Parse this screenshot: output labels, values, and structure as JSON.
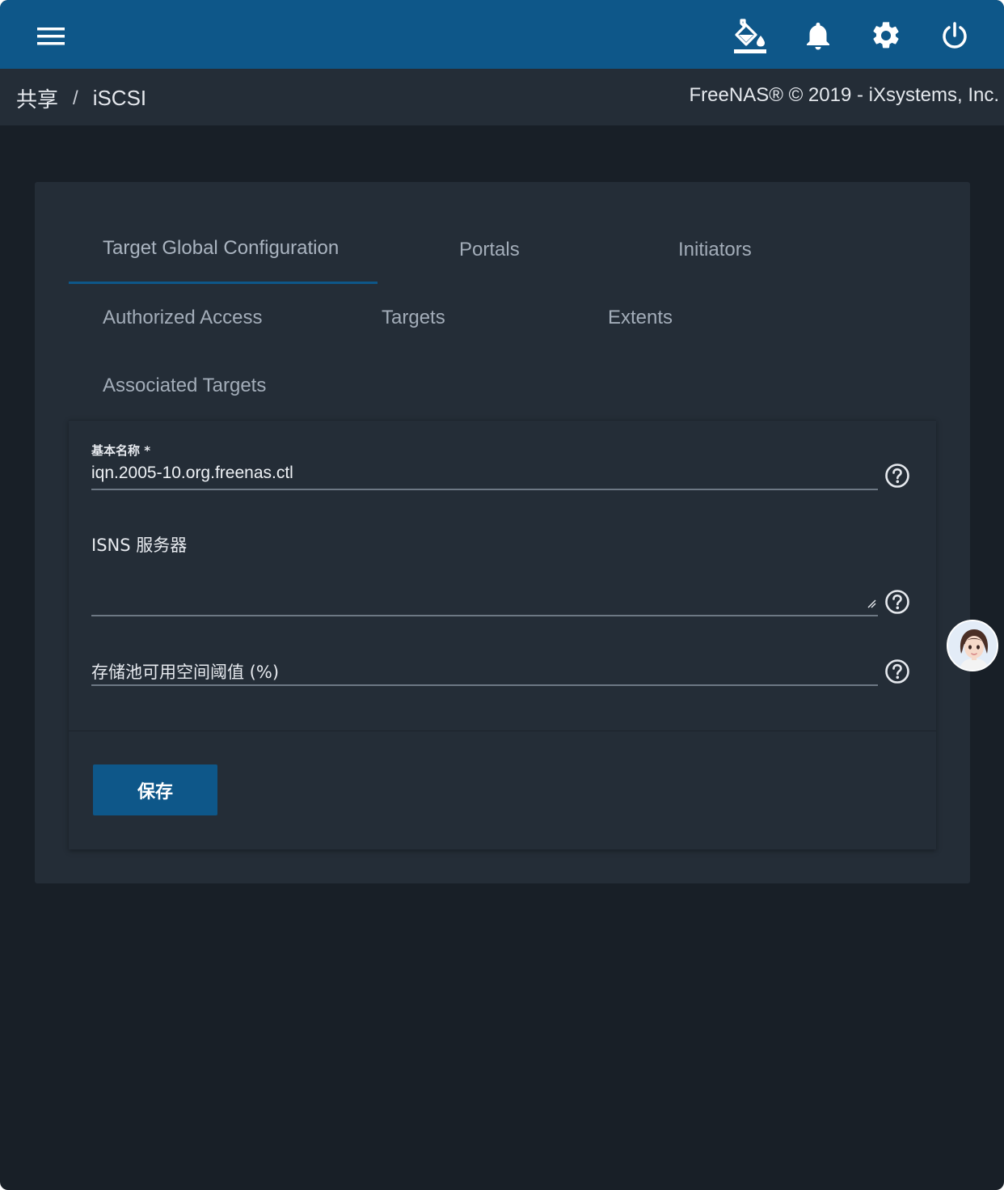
{
  "header": {
    "icons": [
      "menu-icon",
      "theme-paint-icon",
      "bell-icon",
      "gear-icon",
      "power-icon"
    ]
  },
  "breadcrumb": {
    "parent": "共享",
    "separator": "/",
    "current": "iSCSI"
  },
  "copyright": "FreeNAS® © 2019 - iXsystems, Inc.",
  "tabs": [
    {
      "label": "Target Global Configuration",
      "active": true
    },
    {
      "label": "Portals"
    },
    {
      "label": "Initiators"
    },
    {
      "label": "Authorized Access"
    },
    {
      "label": "Targets"
    },
    {
      "label": "Extents"
    },
    {
      "label": "Associated Targets"
    }
  ],
  "form": {
    "base_name_label": "基本名称 *",
    "base_name_value": "iqn.2005-10.org.freenas.ctl",
    "isns_label": "ISNS 服务器",
    "isns_value": "",
    "pool_threshold_label": "存储池可用空间阈值 (%)",
    "pool_threshold_value": "",
    "save_label": "保存"
  },
  "colors": {
    "topbar": "#0e5789",
    "background": "#181f27",
    "card": "#242d37",
    "accent": "#0e5789"
  }
}
